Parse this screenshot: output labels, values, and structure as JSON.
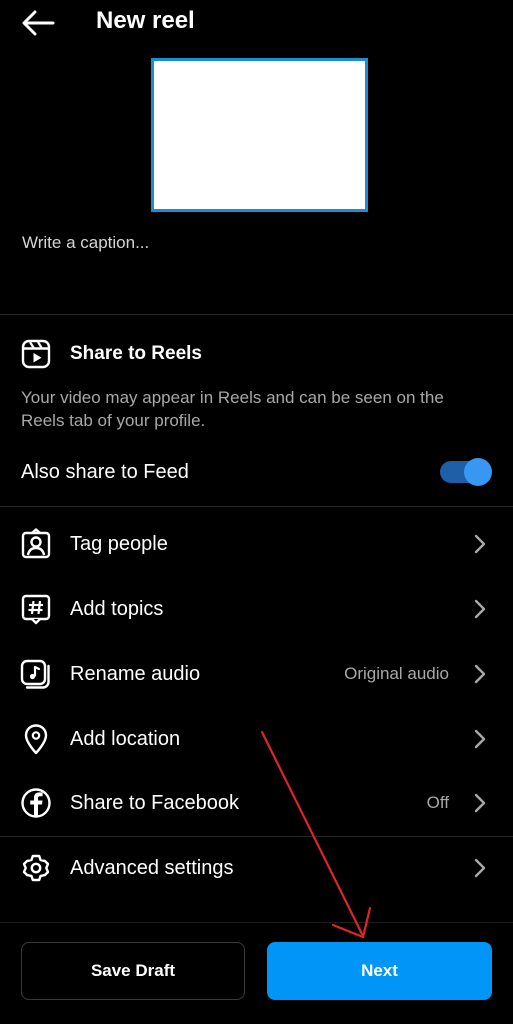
{
  "header": {
    "title": "New reel",
    "back_icon": "arrow-left-icon"
  },
  "caption": {
    "placeholder": "Write a caption...",
    "value": ""
  },
  "share_to_reels": {
    "icon": "reels-icon",
    "title": "Share to Reels",
    "description": "Your video may appear in Reels and can be seen on the Reels tab of your profile."
  },
  "also_share_feed": {
    "label": "Also share to Feed",
    "enabled": true
  },
  "menu": {
    "items": [
      {
        "label": "Tag people",
        "value": "",
        "icon": "tag-people-icon"
      },
      {
        "label": "Add topics",
        "value": "",
        "icon": "hashtag-icon"
      },
      {
        "label": "Rename audio",
        "value": "Original audio",
        "icon": "music-note-icon"
      },
      {
        "label": "Add location",
        "value": "",
        "icon": "location-pin-icon"
      },
      {
        "label": "Share to Facebook",
        "value": "Off",
        "icon": "facebook-icon"
      },
      {
        "label": "Advanced settings",
        "value": "",
        "icon": "gear-icon"
      }
    ]
  },
  "buttons": {
    "save_draft": "Save Draft",
    "next": "Next"
  },
  "colors": {
    "background": "#000000",
    "primary": "#0095f6",
    "toggle_track": "#1f5fa8",
    "thumbnail_border": "#1a8cd8",
    "annotation_arrow": "#e0242b"
  }
}
